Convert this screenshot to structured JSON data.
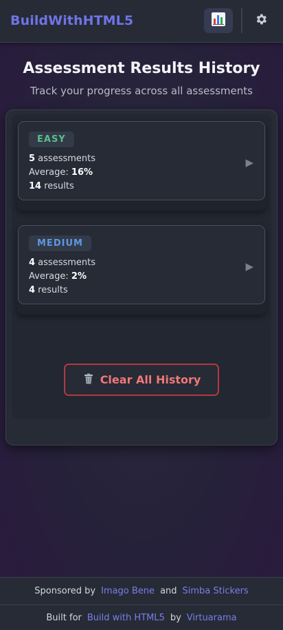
{
  "header": {
    "brand": "BuildWithHTML5",
    "results_icon": "bar-chart-icon",
    "settings_icon": "gear-icon"
  },
  "page": {
    "title": "Assessment Results History",
    "subtitle": "Track your progress across all assessments"
  },
  "groups": [
    {
      "level": "EASY",
      "assessments_count": "5",
      "assessments_label": " assessments",
      "average_label": "Average: ",
      "average_value": "16%",
      "results_count": "14",
      "results_label": " results",
      "arrow": "▶"
    },
    {
      "level": "MEDIUM",
      "assessments_count": "4",
      "assessments_label": " assessments",
      "average_label": "Average: ",
      "average_value": "2%",
      "results_count": "4",
      "results_label": " results",
      "arrow": "▶"
    }
  ],
  "actions": {
    "clear_icon": "trash-icon",
    "clear_label": "Clear All History"
  },
  "footer": {
    "sponsored_by": "Sponsored by",
    "sponsor1": "Imago Bene",
    "and": "and",
    "sponsor2": "Simba Stickers",
    "built_for": "Built for",
    "project": "Build with HTML5",
    "by": "by",
    "author": "Virtuarama"
  },
  "colors": {
    "accent": "#6f74e6",
    "easy": "#57c08a",
    "medium": "#5d98e2",
    "danger": "#b23a40"
  }
}
